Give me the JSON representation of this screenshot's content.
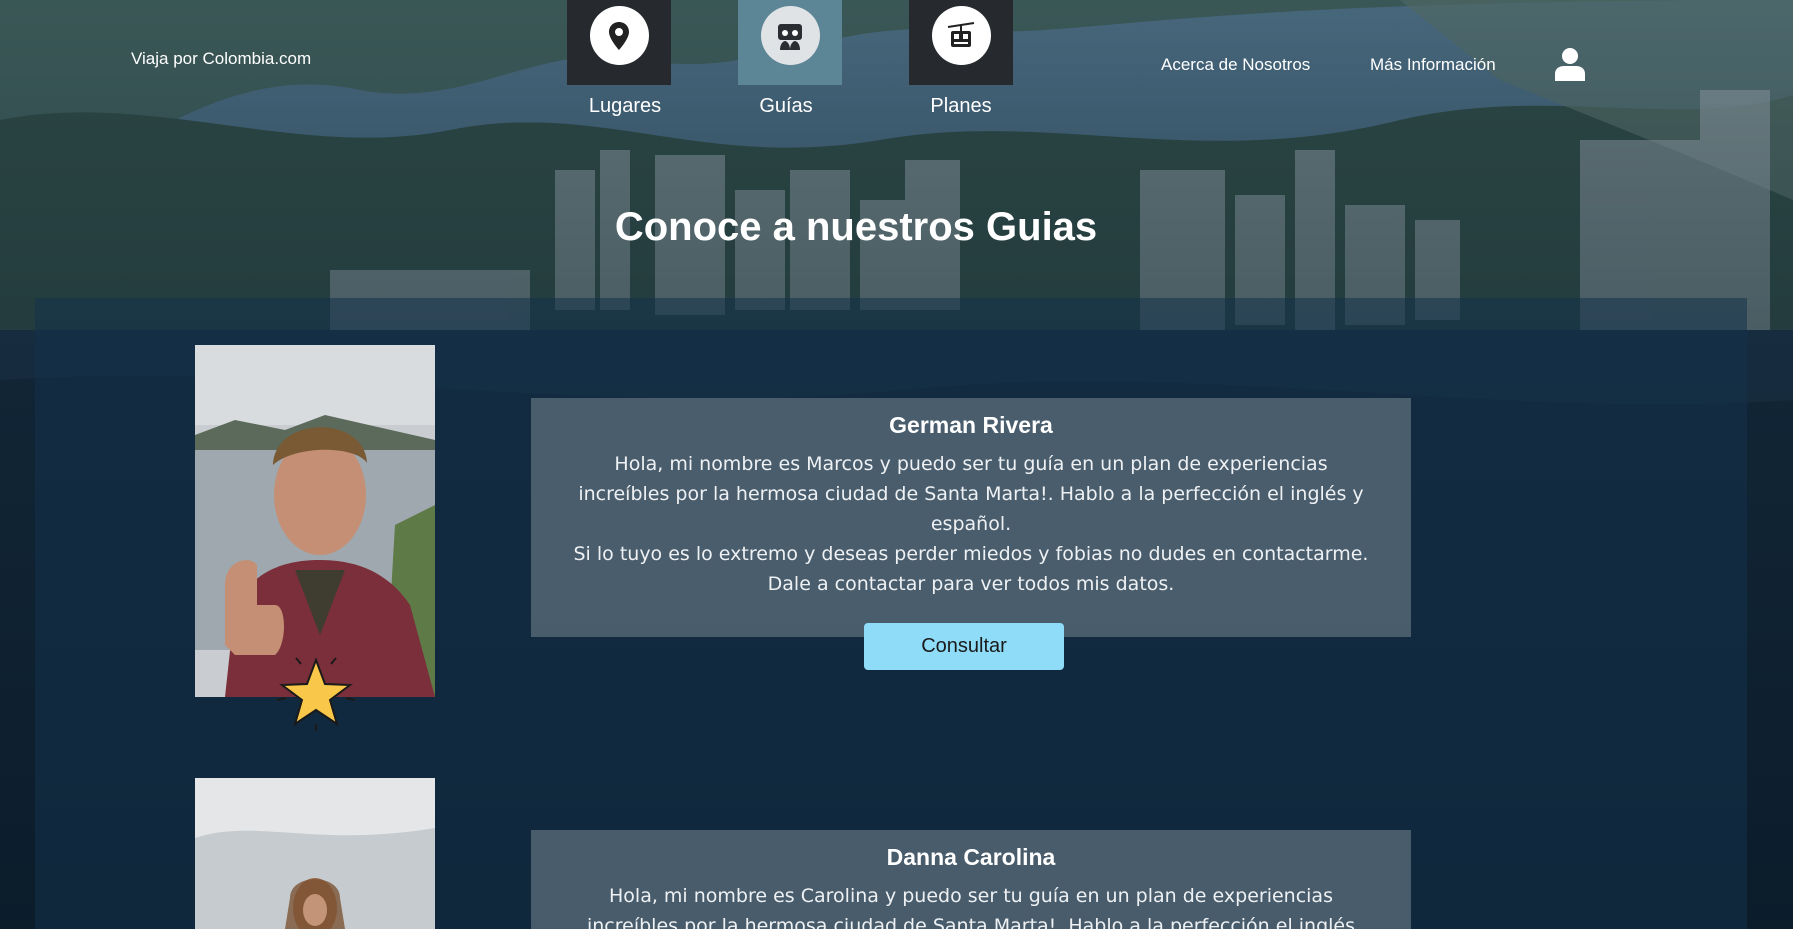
{
  "brand": "Viaja por Colombia.com",
  "nav": {
    "tabs": [
      {
        "label": "Lugares",
        "icon": "location-pin-icon"
      },
      {
        "label": "Guías",
        "icon": "guide-icon"
      },
      {
        "label": "Planes",
        "icon": "cable-car-icon"
      }
    ],
    "active_tab": "Guías"
  },
  "top_links": {
    "about": "Acerca de Nosotros",
    "more_info": "Más Información"
  },
  "user_icon": "user-icon",
  "page_title": "Conoce a nuestros Guias",
  "guides": [
    {
      "name": "German Rivera",
      "bio": [
        "Hola, mi nombre es Marcos y puedo ser tu guía en un plan de experiencias",
        "increíbles por la hermosa ciudad de Santa Marta!. Hablo a la perfección el inglés y",
        "español.",
        "Si lo tuyo es lo extremo y deseas perder miedos y fobias no dudes en contactarme.",
        "Dale a contactar para ver todos mis datos."
      ],
      "button_label": "Consultar",
      "featured_icon": "star-icon"
    },
    {
      "name": "Danna Carolina",
      "bio": [
        "Hola, mi nombre es Carolina y puedo ser tu guía en un plan de experiencias",
        "increíbles por la hermosa ciudad de Santa Marta!. Hablo a la perfección el inglés"
      ]
    }
  ],
  "colors": {
    "nav_tile_dark": "#26292d",
    "nav_tile_active": "#5c8596",
    "button": "#8fdcf8",
    "star": "#f9c84a"
  }
}
